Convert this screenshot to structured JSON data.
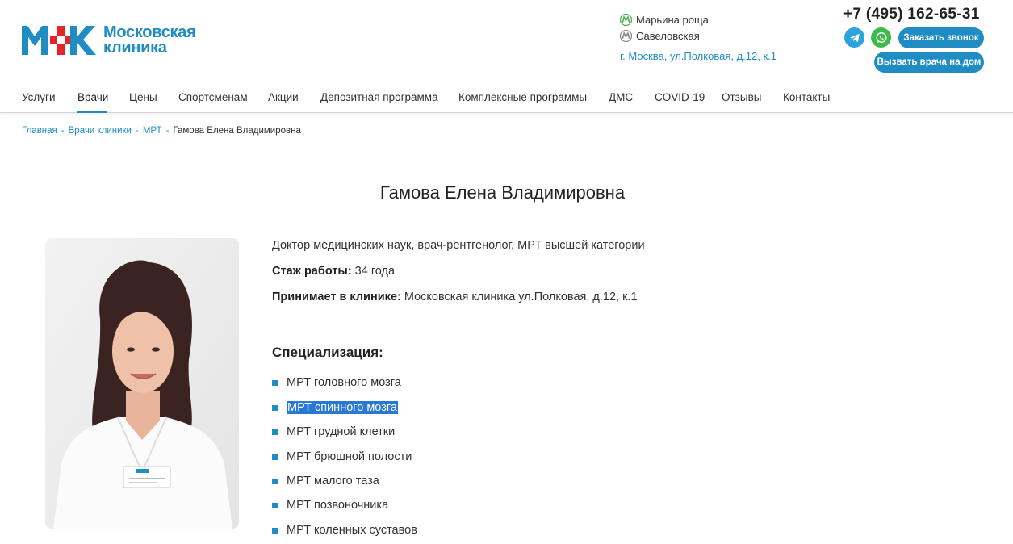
{
  "header": {
    "logo_text_line1": "Московская",
    "logo_text_line2": "клиника",
    "metro_stations": [
      "Марьина роща",
      "Савеловская"
    ],
    "address": "г. Москва, ул.Полковая, д.12, к.1",
    "phone": "+7 (495) 162-65-31",
    "call_button": "Заказать звонок",
    "home_doctor_button": "Вызвать врача на дом",
    "telegram_icon": "telegram-icon",
    "whatsapp_icon": "whatsapp-icon",
    "colors": {
      "brand_blue": "#1f8dc4",
      "brand_red": "#e3262b",
      "metro_green": "#4caf50"
    }
  },
  "nav": {
    "items": [
      "Услуги",
      "Врачи",
      "Цены",
      "Спортсменам",
      "Акции",
      "Депозитная программа",
      "Комплексные программы",
      "ДМС",
      "COVID-19",
      "Отзывы",
      "Контакты"
    ],
    "active": "Врачи"
  },
  "breadcrumb": {
    "items": [
      "Главная",
      "Врачи клиники",
      "МРТ"
    ],
    "current": "Гамова Елена Владимировна"
  },
  "doctor": {
    "name": "Гамова Елена Владимировна",
    "title": "Доктор медицинских наук, врач-рентгенолог, МРТ высшей категории",
    "experience_label": "Стаж работы:",
    "experience_value": "34 года",
    "clinic_label": "Принимает в клинике:",
    "clinic_value": "Московская клиника ул.Полковая, д.12, к.1"
  },
  "specialization": {
    "title": "Специализация:",
    "items": [
      "МРТ головного мозга",
      "МРТ спинного мозга",
      "МРТ грудной клетки",
      "МРТ брюшной полости",
      "МРТ малого таза",
      "МРТ позвоночника",
      "МРТ коленных суставов"
    ],
    "selected_index": 1
  }
}
